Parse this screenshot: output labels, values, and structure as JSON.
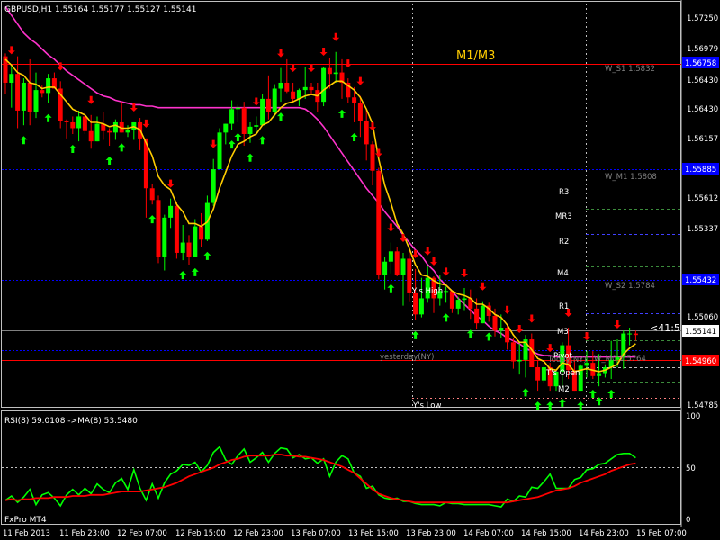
{
  "chart": {
    "symbol_header": "GBPUSD,H1  1.55164 1.55177 1.55127 1.55141",
    "overlay_label": "M1/M3",
    "broker_label": "FxPro MT4",
    "countdown_label": "<41:5",
    "main_price_axis": [
      "1.56979",
      "1.56707",
      "1.56430",
      "1.56157",
      "1.55887",
      "1.55612",
      "1.55337",
      "1.55060",
      "1.54785"
    ],
    "price_axis_top": "1.57250",
    "price_markers": [
      {
        "label": "1.56758",
        "color": "#0000ff"
      },
      {
        "label": "1.55885",
        "color": "#0000ff"
      },
      {
        "label": "1.55432",
        "color": "#0000ff"
      },
      {
        "label": "1.55141",
        "color": "#ffffff"
      },
      {
        "label": "1.54960",
        "color": "#ff0000"
      }
    ],
    "level_labels": [
      {
        "label": "W_S1 1.5832",
        "color": "#808080"
      },
      {
        "label": "W_M1 1.5808",
        "color": "#808080"
      },
      {
        "label": "W_S2 1.5784",
        "color": "#808080"
      },
      {
        "label": "W_M0 1.5764",
        "color": "#808080"
      },
      {
        "label": "R3",
        "color": "#ffffff"
      },
      {
        "label": "MR3",
        "color": "#ffffff"
      },
      {
        "label": "R2",
        "color": "#ffffff"
      },
      {
        "label": "M4",
        "color": "#ffffff"
      },
      {
        "label": "R1",
        "color": "#ffffff"
      },
      {
        "label": "M3",
        "color": "#ffffff"
      },
      {
        "label": "Pivot",
        "color": "#ffffff"
      },
      {
        "label": "T's Open",
        "color": "#ffffff"
      },
      {
        "label": "M2",
        "color": "#ffffff"
      },
      {
        "label": "Y's High",
        "color": "#ffffff"
      },
      {
        "label": "Y's Low",
        "color": "#ffffff"
      },
      {
        "label": "yesterday(NY)",
        "color": "#808080"
      },
      {
        "label": "Today(NY)",
        "color": "#808080"
      }
    ],
    "time_axis": [
      "11 Feb 2013",
      "11 Feb 23:00",
      "12 Feb 07:00",
      "12 Feb 15:00",
      "12 Feb 23:00",
      "13 Feb 07:00",
      "13 Feb 15:00",
      "13 Feb 23:00",
      "14 Feb 07:00",
      "14 Feb 15:00",
      "14 Feb 23:00",
      "15 Feb 07:00"
    ],
    "colors": {
      "bull": "#00ff00",
      "bear": "#ff0000",
      "ma_fast": "#ffcc00",
      "ma_slow": "#ff33cc",
      "rsi": "#00ff00",
      "rsi_ma": "#ff0000",
      "up_arrow": "#00ff00",
      "down_arrow": "#ff0000"
    }
  },
  "indicator": {
    "header": "RSI(8) 59.0108  ->MA(8) 53.5480",
    "axis": [
      "100",
      "50",
      "0"
    ]
  },
  "chart_data": {
    "type": "candlestick",
    "symbol": "GBPUSD",
    "timeframe": "H1",
    "ylim": [
      1.5465,
      1.574
    ],
    "candles": [
      [
        1.5704,
        1.5706,
        1.5678,
        1.5686
      ],
      [
        1.5686,
        1.5698,
        1.5669,
        1.5692
      ],
      [
        1.5692,
        1.5704,
        1.5655,
        1.5667
      ],
      [
        1.5667,
        1.5689,
        1.5657,
        1.5686
      ],
      [
        1.5686,
        1.5702,
        1.5657,
        1.5666
      ],
      [
        1.5666,
        1.5693,
        1.5662,
        1.5681
      ],
      [
        1.5681,
        1.5684,
        1.5676,
        1.5679
      ],
      [
        1.5679,
        1.5692,
        1.5672,
        1.5689
      ],
      [
        1.5689,
        1.5693,
        1.5682,
        1.5682
      ],
      [
        1.5682,
        1.5687,
        1.5655,
        1.566
      ],
      [
        1.566,
        1.5661,
        1.5648,
        1.5659
      ],
      [
        1.5659,
        1.5663,
        1.5651,
        1.5655
      ],
      [
        1.5655,
        1.5667,
        1.5646,
        1.5663
      ],
      [
        1.5663,
        1.5666,
        1.5651,
        1.5653
      ],
      [
        1.5653,
        1.5664,
        1.5641,
        1.5646
      ],
      [
        1.5646,
        1.5663,
        1.5646,
        1.5658
      ],
      [
        1.5658,
        1.5666,
        1.5647,
        1.5653
      ],
      [
        1.5653,
        1.5655,
        1.5643,
        1.5652
      ],
      [
        1.5652,
        1.5661,
        1.5647,
        1.5659
      ],
      [
        1.5659,
        1.5673,
        1.5652,
        1.5652
      ],
      [
        1.5652,
        1.5657,
        1.5649,
        1.5654
      ],
      [
        1.5654,
        1.5659,
        1.5647,
        1.5659
      ],
      [
        1.5659,
        1.5662,
        1.564,
        1.5648
      ],
      [
        1.5648,
        1.5648,
        1.5594,
        1.5614
      ],
      [
        1.5614,
        1.5617,
        1.5603,
        1.5606
      ],
      [
        1.5606,
        1.5609,
        1.5563,
        1.5567
      ],
      [
        1.5567,
        1.5596,
        1.5558,
        1.5594
      ],
      [
        1.5594,
        1.5607,
        1.5587,
        1.5602
      ],
      [
        1.5602,
        1.5605,
        1.5566,
        1.557
      ],
      [
        1.557,
        1.5589,
        1.5565,
        1.5577
      ],
      [
        1.5577,
        1.5582,
        1.5562,
        1.5567
      ],
      [
        1.5567,
        1.5593,
        1.5567,
        1.5588
      ],
      [
        1.5588,
        1.5597,
        1.5574,
        1.5579
      ],
      [
        1.5579,
        1.5609,
        1.5578,
        1.5604
      ],
      [
        1.5604,
        1.5634,
        1.5602,
        1.5627
      ],
      [
        1.5627,
        1.5655,
        1.5627,
        1.5652
      ],
      [
        1.5652,
        1.5658,
        1.5644,
        1.5658
      ],
      [
        1.5658,
        1.5674,
        1.5654,
        1.5668
      ],
      [
        1.5668,
        1.5671,
        1.5659,
        1.5669
      ],
      [
        1.5669,
        1.5673,
        1.5643,
        1.5651
      ],
      [
        1.5651,
        1.5659,
        1.5645,
        1.5656
      ],
      [
        1.5656,
        1.5663,
        1.5651,
        1.5657
      ],
      [
        1.5657,
        1.5678,
        1.5657,
        1.5675
      ],
      [
        1.5675,
        1.5691,
        1.5661,
        1.5666
      ],
      [
        1.5666,
        1.5685,
        1.5663,
        1.5682
      ],
      [
        1.5682,
        1.5696,
        1.5673,
        1.5686
      ],
      [
        1.5686,
        1.5702,
        1.5679,
        1.568
      ],
      [
        1.568,
        1.5686,
        1.5673,
        1.5675
      ],
      [
        1.5675,
        1.5682,
        1.567,
        1.5681
      ],
      [
        1.5681,
        1.5697,
        1.5675,
        1.5683
      ],
      [
        1.5683,
        1.5686,
        1.5678,
        1.5681
      ],
      [
        1.5681,
        1.5686,
        1.5666,
        1.5673
      ],
      [
        1.5673,
        1.5697,
        1.567,
        1.5696
      ],
      [
        1.5696,
        1.5703,
        1.5682,
        1.5692
      ],
      [
        1.5692,
        1.5707,
        1.5686,
        1.5693
      ],
      [
        1.5693,
        1.5702,
        1.5675,
        1.5686
      ],
      [
        1.5686,
        1.5689,
        1.5672,
        1.5676
      ],
      [
        1.5676,
        1.5683,
        1.5659,
        1.5672
      ],
      [
        1.5672,
        1.5677,
        1.5649,
        1.566
      ],
      [
        1.566,
        1.5668,
        1.5633,
        1.5644
      ],
      [
        1.5644,
        1.5646,
        1.5616,
        1.5626
      ],
      [
        1.5626,
        1.5628,
        1.5552,
        1.5555
      ],
      [
        1.5555,
        1.5567,
        1.5545,
        1.5564
      ],
      [
        1.5564,
        1.5577,
        1.5556,
        1.5571
      ],
      [
        1.5571,
        1.5574,
        1.5554,
        1.5555
      ],
      [
        1.5555,
        1.557,
        1.5534,
        1.5566
      ],
      [
        1.5566,
        1.5571,
        1.5537,
        1.5543
      ],
      [
        1.5543,
        1.5559,
        1.5524,
        1.5528
      ],
      [
        1.5528,
        1.5553,
        1.5526,
        1.5539
      ],
      [
        1.5539,
        1.5561,
        1.5536,
        1.5553
      ],
      [
        1.5553,
        1.5554,
        1.5529,
        1.5539
      ],
      [
        1.5539,
        1.5555,
        1.5534,
        1.5544
      ],
      [
        1.5544,
        1.5547,
        1.5536,
        1.5544
      ],
      [
        1.5544,
        1.5544,
        1.5529,
        1.5532
      ],
      [
        1.5532,
        1.554,
        1.5528,
        1.5538
      ],
      [
        1.5538,
        1.5546,
        1.5531,
        1.5539
      ],
      [
        1.5539,
        1.5545,
        1.5525,
        1.5532
      ],
      [
        1.5532,
        1.5539,
        1.5518,
        1.5522
      ],
      [
        1.5522,
        1.5537,
        1.5522,
        1.5534
      ],
      [
        1.5534,
        1.5536,
        1.5523,
        1.5527
      ],
      [
        1.5527,
        1.5532,
        1.5513,
        1.5517
      ],
      [
        1.5517,
        1.5528,
        1.5512,
        1.5519
      ],
      [
        1.5519,
        1.5521,
        1.5504,
        1.5509
      ],
      [
        1.5509,
        1.5512,
        1.5491,
        1.5496
      ],
      [
        1.5496,
        1.5508,
        1.5487,
        1.5497
      ],
      [
        1.5497,
        1.5514,
        1.5485,
        1.5511
      ],
      [
        1.5511,
        1.5515,
        1.5492,
        1.5492
      ],
      [
        1.5492,
        1.5497,
        1.5476,
        1.5483
      ],
      [
        1.5483,
        1.5493,
        1.5481,
        1.5492
      ],
      [
        1.5492,
        1.5495,
        1.5476,
        1.5479
      ],
      [
        1.5479,
        1.5489,
        1.5476,
        1.5489
      ],
      [
        1.5489,
        1.5509,
        1.5478,
        1.5507
      ],
      [
        1.5507,
        1.5519,
        1.5484,
        1.549
      ],
      [
        1.549,
        1.5497,
        1.5476,
        1.5476
      ],
      [
        1.5476,
        1.5494,
        1.5476,
        1.5493
      ],
      [
        1.5493,
        1.5503,
        1.5485,
        1.5495
      ],
      [
        1.5495,
        1.5503,
        1.5484,
        1.5486
      ],
      [
        1.5486,
        1.5501,
        1.5479,
        1.5488
      ],
      [
        1.5488,
        1.5494,
        1.5485,
        1.5492
      ],
      [
        1.5492,
        1.551,
        1.5484,
        1.5497
      ],
      [
        1.5497,
        1.5511,
        1.5492,
        1.5499
      ],
      [
        1.5499,
        1.5517,
        1.5491,
        1.5515
      ],
      [
        1.5515,
        1.5519,
        1.5507,
        1.5515
      ],
      [
        1.5515,
        1.5517,
        1.551,
        1.5514
      ]
    ],
    "ma_fast": [
      1.5702,
      1.5698,
      1.5693,
      1.5691,
      1.5686,
      1.5685,
      1.5682,
      1.5683,
      1.5683,
      1.5678,
      1.5673,
      1.5668,
      1.5666,
      1.5664,
      1.5659,
      1.5659,
      1.5658,
      1.5656,
      1.5657,
      1.5655,
      1.5655,
      1.5656,
      1.5654,
      1.5645,
      1.5636,
      1.5622,
      1.5616,
      1.5613,
      1.5603,
      1.5598,
      1.559,
      1.559,
      1.5588,
      1.5591,
      1.56,
      1.5614,
      1.5625,
      1.5636,
      1.5644,
      1.5646,
      1.5649,
      1.5651,
      1.5657,
      1.5659,
      1.5664,
      1.5669,
      1.5672,
      1.5673,
      1.5675,
      1.5677,
      1.5678,
      1.5677,
      1.5681,
      1.5684,
      1.5687,
      1.5687,
      1.5684,
      1.5681,
      1.5676,
      1.5668,
      1.5658,
      1.5634,
      1.5616,
      1.5604,
      1.559,
      1.5583,
      1.5573,
      1.5562,
      1.5555,
      1.5554,
      1.5551,
      1.5549,
      1.5548,
      1.5544,
      1.5542,
      1.5541,
      1.5539,
      1.5535,
      1.5535,
      1.5532,
      1.5528,
      1.5526,
      1.5521,
      1.5514,
      1.5509,
      1.5509,
      1.5504,
      1.5498,
      1.5496,
      1.5491,
      1.549,
      1.5495,
      1.5494,
      1.5489,
      1.549,
      1.5491,
      1.549,
      1.5489,
      1.549,
      1.5492,
      1.5494,
      1.5501,
      1.5505,
      1.5508
    ],
    "ma_slow": [
      1.5738,
      1.5732,
      1.5726,
      1.572,
      1.5716,
      1.5713,
      1.5709,
      1.5705,
      1.5702,
      1.5698,
      1.5694,
      1.5691,
      1.5688,
      1.5685,
      1.5682,
      1.5679,
      1.5677,
      1.5676,
      1.5674,
      1.5673,
      1.5672,
      1.5671,
      1.5671,
      1.567,
      1.567,
      1.5669,
      1.5669,
      1.5669,
      1.5669,
      1.5669,
      1.5669,
      1.5669,
      1.5669,
      1.5669,
      1.5669,
      1.5669,
      1.5669,
      1.5669,
      1.5669,
      1.5669,
      1.5669,
      1.5669,
      1.5669,
      1.5669,
      1.5669,
      1.5669,
      1.5669,
      1.5669,
      1.5669,
      1.5668,
      1.5665,
      1.5661,
      1.5656,
      1.565,
      1.5644,
      1.5638,
      1.5632,
      1.5626,
      1.562,
      1.5614,
      1.5609,
      1.5604,
      1.5598,
      1.5593,
      1.5588,
      1.5582,
      1.5577,
      1.5572,
      1.5568,
      1.5562,
      1.5558,
      1.5552,
      1.5548,
      1.5544,
      1.5539,
      1.5535,
      1.5531,
      1.5527,
      1.5524,
      1.552,
      1.5517,
      1.5515,
      1.5512,
      1.551,
      1.5508,
      1.5505,
      1.5503,
      1.5501,
      1.55,
      1.55,
      1.5499,
      1.5499,
      1.5499,
      1.5499,
      1.5499,
      1.5499,
      1.5499,
      1.5499,
      1.5499,
      1.5499,
      1.5499,
      1.5499,
      1.5499,
      1.5499
    ],
    "rsi": [
      20,
      24,
      18,
      23,
      30,
      16,
      25,
      27,
      22,
      15,
      25,
      30,
      25,
      31,
      26,
      35,
      30,
      27,
      36,
      40,
      30,
      48,
      31,
      20,
      35,
      22,
      36,
      44,
      47,
      53,
      52,
      55,
      46,
      52,
      64,
      69,
      57,
      53,
      61,
      67,
      55,
      59,
      64,
      55,
      63,
      68,
      67,
      59,
      62,
      58,
      59,
      54,
      58,
      42,
      55,
      61,
      58,
      45,
      42,
      31,
      33,
      25,
      22,
      21,
      22,
      19,
      19,
      17,
      16,
      16,
      16,
      15,
      18,
      17,
      17,
      16,
      16,
      16,
      16,
      16,
      15,
      14,
      21,
      19,
      24,
      23,
      32,
      31,
      37,
      44,
      31,
      31,
      31,
      39,
      41,
      48,
      49,
      53,
      54,
      58,
      62,
      63,
      63,
      59
    ],
    "rsi_ma": [
      20,
      21,
      20,
      21,
      21,
      22,
      22,
      22,
      23,
      23,
      23,
      24,
      24,
      24,
      25,
      25,
      25,
      26,
      27,
      28,
      28,
      28,
      28,
      29,
      30,
      31,
      32,
      34,
      36,
      39,
      42,
      44,
      46,
      48,
      50,
      53,
      55,
      57,
      58,
      60,
      61,
      61,
      61,
      61,
      62,
      62,
      61,
      61,
      60,
      60,
      59,
      58,
      57,
      55,
      53,
      51,
      48,
      45,
      40,
      35,
      30,
      26,
      24,
      22,
      21,
      20,
      19,
      18,
      18,
      18,
      18,
      18,
      18,
      18,
      18,
      18,
      18,
      18,
      18,
      18,
      18,
      18,
      18,
      19,
      20,
      21,
      22,
      23,
      25,
      27,
      29,
      30,
      31,
      33,
      36,
      38,
      40,
      42,
      44,
      47,
      49,
      51,
      53,
      54
    ],
    "up_arrows": [
      3,
      7,
      11,
      17,
      19,
      24,
      29,
      31,
      33,
      37,
      38,
      40,
      42,
      45,
      55,
      57,
      63,
      67,
      72,
      76,
      79,
      85,
      87,
      89,
      91,
      94,
      96,
      97,
      99
    ],
    "down_arrows": [
      1,
      9,
      14,
      21,
      23,
      27,
      34,
      41,
      45,
      47,
      50,
      52,
      54,
      56,
      58,
      60,
      61,
      63,
      65,
      67,
      69,
      70,
      72,
      75,
      78,
      82,
      84,
      86,
      89,
      92,
      95,
      100
    ]
  }
}
